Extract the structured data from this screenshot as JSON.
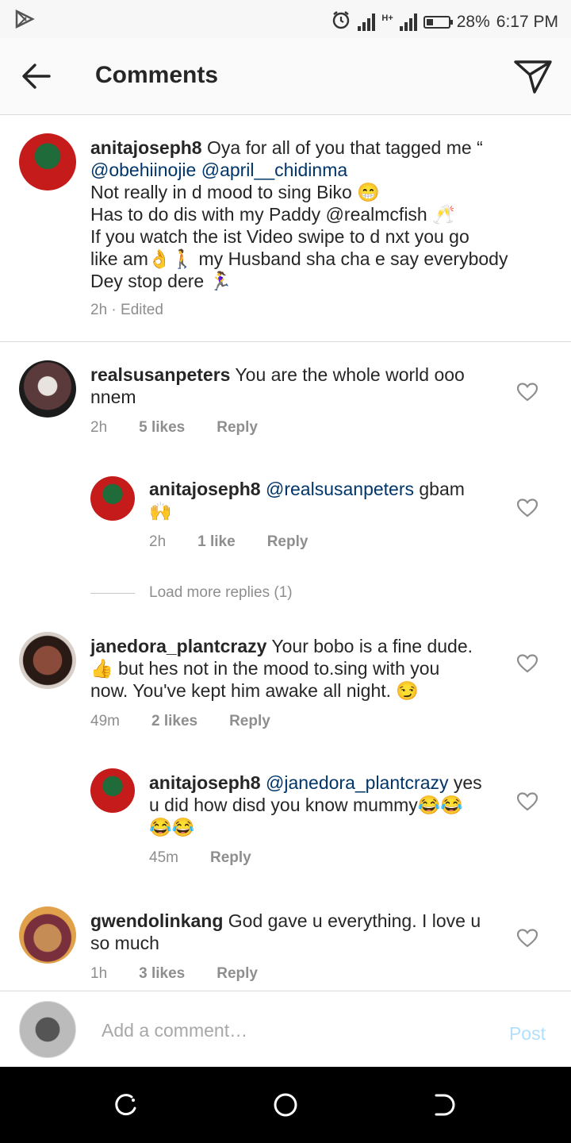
{
  "status": {
    "battery": "28%",
    "time": "6:17 PM",
    "network": "H+"
  },
  "header": {
    "title": "Comments"
  },
  "caption": {
    "username": "anitajoseph8",
    "lines": [
      "Oya for all of you that tagged me “",
      "@obehiinojie @april__chidinma",
      "Not really in d mood to sing Biko 😁",
      "Has to do dis with my Paddy @realmcfish 🥂",
      "If you watch the ist Video swipe to d nxt you go",
      "like am👌🚶 my Husband sha cha e say everybody",
      "Dey stop dere 🏃‍♀️"
    ],
    "meta": "2h · Edited"
  },
  "comments": [
    {
      "username": "realsusanpeters",
      "text_line1": "You are the whole world ooo",
      "text_line2": "nnem",
      "time": "2h",
      "likes": "5 likes",
      "reply": "Reply"
    },
    {
      "username": "anitajoseph8",
      "mention": "@realsusanpeters",
      "text": " gbam",
      "text_line2": "🙌",
      "time": "2h",
      "likes": "1 like",
      "reply": "Reply"
    },
    {
      "username": "janedora_plantcrazy",
      "text_line1": "Your bobo is a fine dude.",
      "text_line2": "👍 but hes not in the mood to.sing with you",
      "text_line3": "now. You've kept him awake all night. 😏",
      "time": "49m",
      "likes": "2 likes",
      "reply": "Reply"
    },
    {
      "username": "anitajoseph8",
      "mention": "@janedora_plantcrazy",
      "text": " yes",
      "text_line2": "u did how disd you know mummy😂😂",
      "text_line3": "😂😂",
      "time": "45m",
      "reply": "Reply"
    },
    {
      "username": "gwendolinkang",
      "text_line1": "God gave u everything. I love u",
      "text_line2": "so much",
      "time": "1h",
      "likes": "3 likes",
      "reply": "Reply"
    }
  ],
  "load_more": "Load more replies (1)",
  "input": {
    "placeholder": "Add a comment…",
    "post": "Post"
  },
  "colors": {
    "mention": "#003569",
    "post_disabled": "#b2dffc",
    "meta": "#8e8e8e"
  }
}
